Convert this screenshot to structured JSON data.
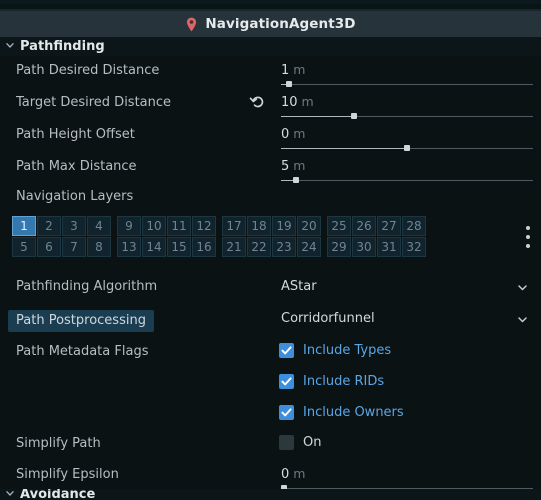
{
  "window": {
    "node_title": "NavigationAgent3D",
    "node_icon": "map-pin-icon",
    "accent_color": "#3d8fdd",
    "pin_color": "#e06464"
  },
  "sections": {
    "pathfinding": {
      "label": "Pathfinding",
      "expanded": true,
      "chevron": "chevron-down-icon"
    },
    "avoidance": {
      "label": "Avoidance",
      "expanded": true,
      "chevron": "chevron-down-icon"
    }
  },
  "properties": {
    "path_desired_distance": {
      "label": "Path Desired Distance",
      "value": "1",
      "unit": "m",
      "slider_percent": 3,
      "has_revert": false
    },
    "target_desired_distance": {
      "label": "Target Desired Distance",
      "value": "10",
      "unit": "m",
      "slider_percent": 29,
      "has_revert": true,
      "revert_icon": "revert-arrow-icon"
    },
    "path_height_offset": {
      "label": "Path Height Offset",
      "value": "0",
      "unit": "m",
      "slider_percent": 50,
      "has_revert": false
    },
    "path_max_distance": {
      "label": "Path Max Distance",
      "value": "5",
      "unit": "m",
      "slider_percent": 6,
      "has_revert": false
    },
    "navigation_layers": {
      "label": "Navigation Layers",
      "groups": [
        {
          "top": [
            "1",
            "2",
            "3",
            "4"
          ],
          "bottom": [
            "5",
            "6",
            "7",
            "8"
          ]
        },
        {
          "top": [
            "9",
            "10",
            "11",
            "12"
          ],
          "bottom": [
            "13",
            "14",
            "15",
            "16"
          ]
        },
        {
          "top": [
            "17",
            "18",
            "19",
            "20"
          ],
          "bottom": [
            "21",
            "22",
            "23",
            "24"
          ]
        },
        {
          "top": [
            "25",
            "26",
            "27",
            "28"
          ],
          "bottom": [
            "29",
            "30",
            "31",
            "32"
          ]
        }
      ],
      "selected": [
        "1"
      ],
      "menu_icon": "kebab-menu-icon"
    },
    "pathfinding_algorithm": {
      "label": "Pathfinding Algorithm",
      "value": "AStar",
      "chevron": "chevron-down-icon",
      "highlighted": false
    },
    "path_postprocessing": {
      "label": "Path Postprocessing",
      "value": "Corridorfunnel",
      "chevron": "chevron-down-icon",
      "highlighted": true
    },
    "path_metadata_flags": {
      "label": "Path Metadata Flags",
      "flags": [
        {
          "label": "Include Types",
          "checked": true
        },
        {
          "label": "Include RIDs",
          "checked": true
        },
        {
          "label": "Include Owners",
          "checked": true
        }
      ]
    },
    "simplify_path": {
      "label": "Simplify Path",
      "toggle_label": "On",
      "checked": false
    },
    "simplify_epsilon": {
      "label": "Simplify Epsilon",
      "value": "0",
      "unit": "m",
      "slider_percent": 1,
      "has_revert": false
    }
  }
}
